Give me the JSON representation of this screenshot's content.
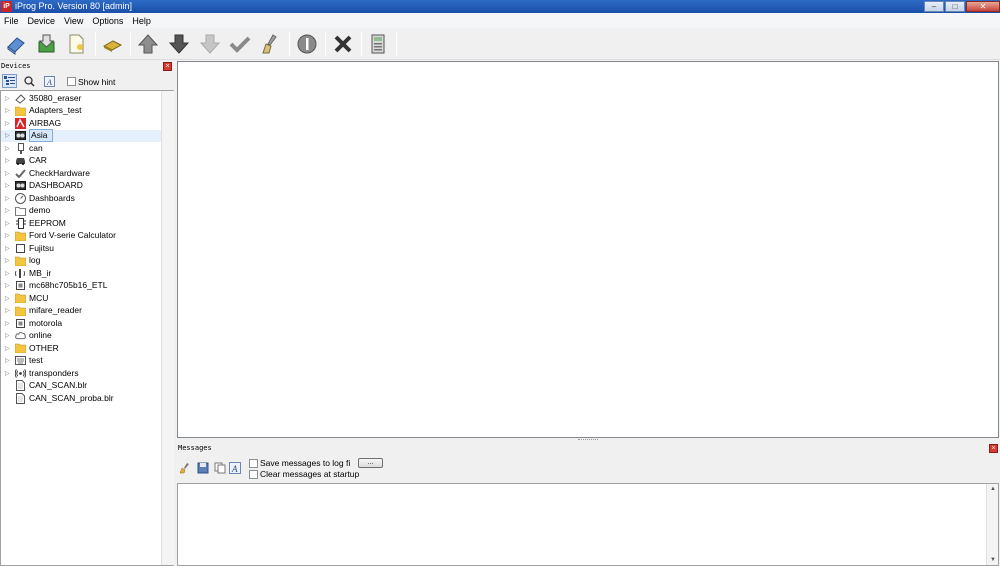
{
  "window": {
    "title": "iProg Pro. Version 80 [admin]",
    "app_icon": "iP",
    "controls": {
      "minimize": "–",
      "maximize": "□",
      "close": "✕"
    }
  },
  "menu": [
    "File",
    "Device",
    "View",
    "Options",
    "Help"
  ],
  "toolbar": [
    {
      "icon": "read-icon"
    },
    {
      "icon": "save-icon"
    },
    {
      "icon": "open-file-icon"
    },
    {
      "icon": "chip-icon"
    },
    {
      "icon": "arrow-up-icon"
    },
    {
      "icon": "arrow-down-icon"
    },
    {
      "icon": "arrow-down-disabled-icon"
    },
    {
      "icon": "check-icon"
    },
    {
      "icon": "brush-icon"
    },
    {
      "icon": "info-icon"
    },
    {
      "icon": "stop-icon"
    },
    {
      "icon": "calculator-icon"
    }
  ],
  "devices": {
    "title": "Devices",
    "show_hint_label": "Show hint",
    "items": [
      {
        "label": "35080_eraser",
        "icon": "eraser-icon"
      },
      {
        "label": "Adapters_test",
        "icon": "folder-icon"
      },
      {
        "label": "AIRBAG",
        "icon": "airbag-icon"
      },
      {
        "label": "Asia",
        "icon": "dashboard-icon",
        "selected": true
      },
      {
        "label": "can",
        "icon": "connector-icon"
      },
      {
        "label": "CAR",
        "icon": "car-icon"
      },
      {
        "label": "CheckHardware",
        "icon": "check-icon"
      },
      {
        "label": "DASHBOARD",
        "icon": "dashboard-icon"
      },
      {
        "label": "Dashboards",
        "icon": "gauge-icon"
      },
      {
        "label": "demo",
        "icon": "folder-outline-icon"
      },
      {
        "label": "EEPROM",
        "icon": "eeprom-icon"
      },
      {
        "label": "Ford V-serie Calculator",
        "icon": "folder-icon"
      },
      {
        "label": "Fujitsu",
        "icon": "chip-outline-icon"
      },
      {
        "label": "log",
        "icon": "folder-icon"
      },
      {
        "label": "MB_ir",
        "icon": "ir-icon"
      },
      {
        "label": "mc68hc705b16_ETL",
        "icon": "mcu-icon"
      },
      {
        "label": "MCU",
        "icon": "folder-icon"
      },
      {
        "label": "mifare_reader",
        "icon": "folder-icon"
      },
      {
        "label": "motorola",
        "icon": "mcu-icon"
      },
      {
        "label": "online",
        "icon": "cloud-icon"
      },
      {
        "label": "OTHER",
        "icon": "folder-icon"
      },
      {
        "label": "test",
        "icon": "keyboard-icon"
      },
      {
        "label": "transponders",
        "icon": "radio-icon"
      },
      {
        "label": "CAN_SCAN.blr",
        "icon": "file-icon",
        "leaf": true
      },
      {
        "label": "CAN_SCAN_proba.blr",
        "icon": "file-icon",
        "leaf": true
      }
    ]
  },
  "messages": {
    "title": "Messages",
    "save_label": "Save messages to log fi",
    "browse_label": "...",
    "clear_label": "Clear messages at startup"
  }
}
